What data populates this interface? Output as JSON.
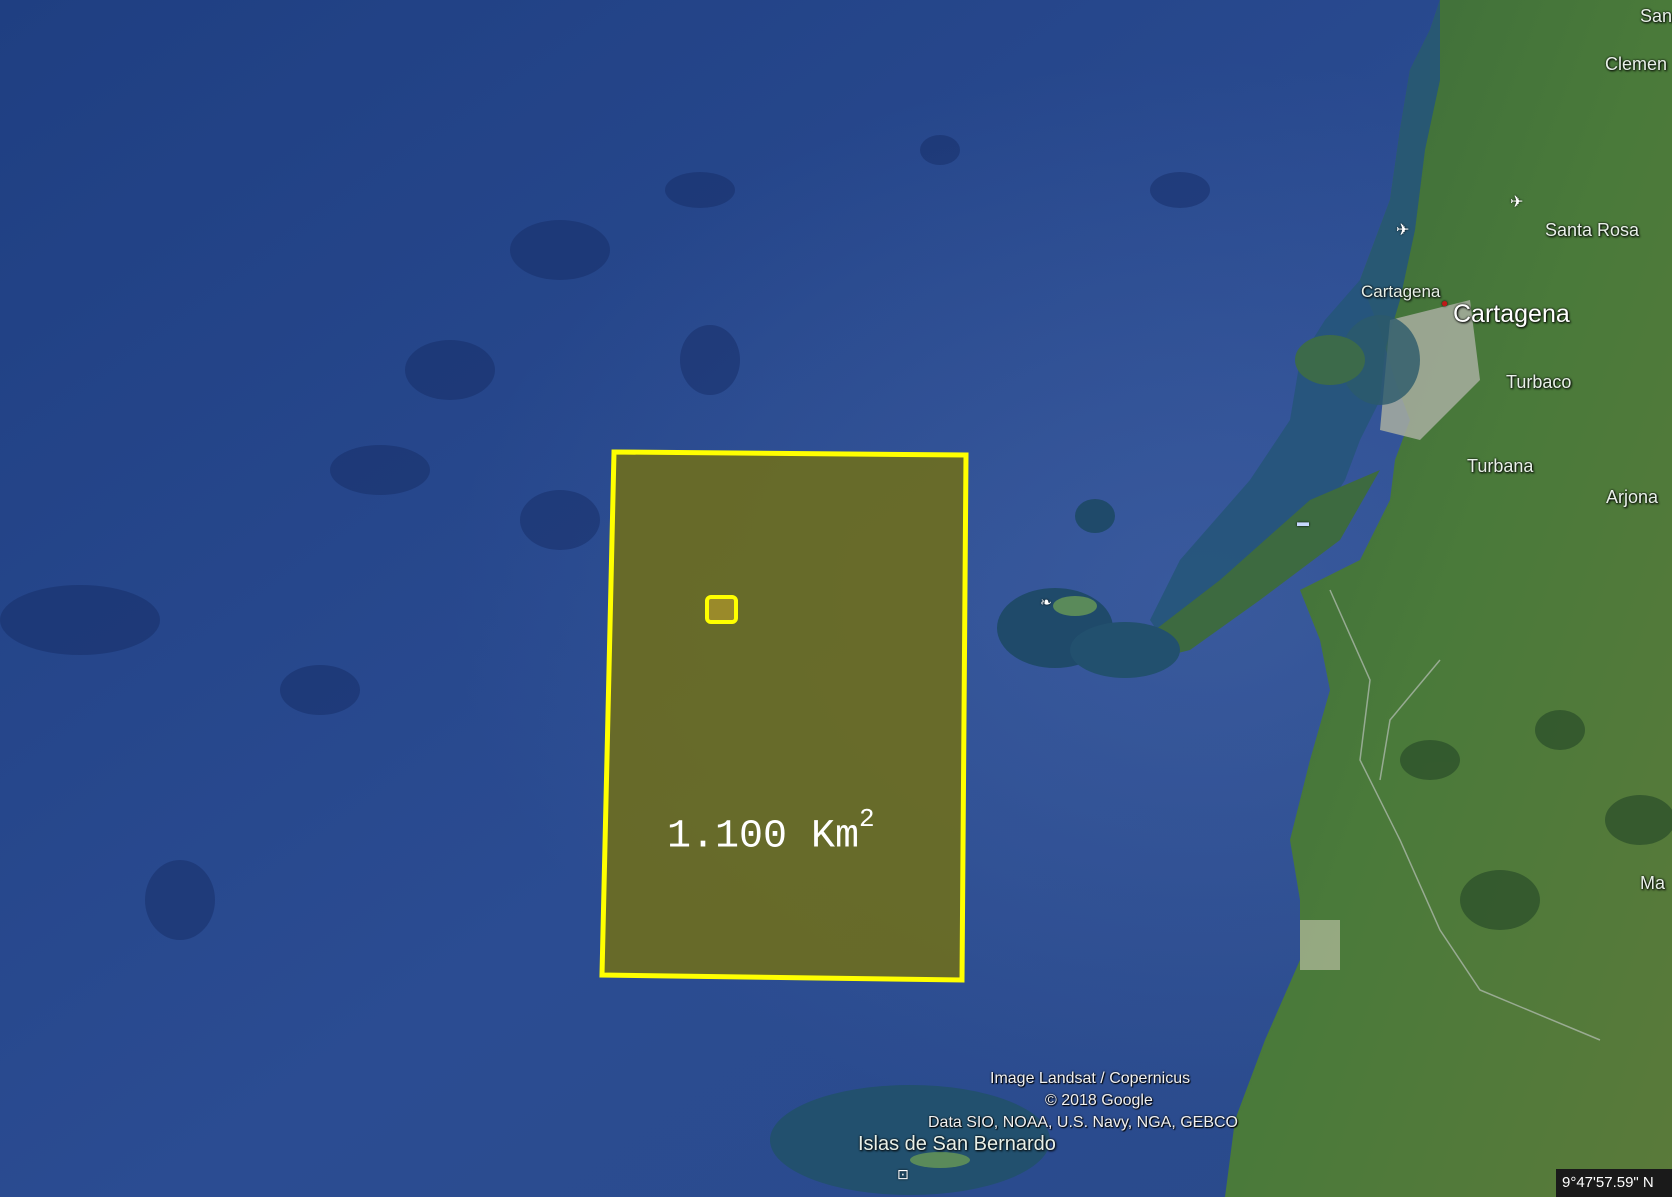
{
  "places": {
    "san": "San",
    "clemente": "Clemen",
    "santa_rosa": "Santa Rosa",
    "cartagena_small": "Cartagena",
    "cartagena": "Cartagena",
    "turbaco": "Turbaco",
    "turbana": "Turbana",
    "arjona": "Arjona",
    "ma": "Ma",
    "islas_san_bernardo": "Islas de San Bernardo"
  },
  "polygon": {
    "area_value": "1.100 Km",
    "area_exponent": "2",
    "stroke_color": "#ffff00",
    "fill_color": "#6e6e1e"
  },
  "attribution": {
    "line1": "Image Landsat / Copernicus",
    "line2": "© 2018 Google",
    "line3": "Data SIO, NOAA, U.S. Navy, NGA, GEBCO"
  },
  "status_bar": {
    "coordinates": "9°47'57.59\" N"
  },
  "icons": {
    "airport": "airport-icon",
    "place_marker": "place-marker-icon"
  }
}
